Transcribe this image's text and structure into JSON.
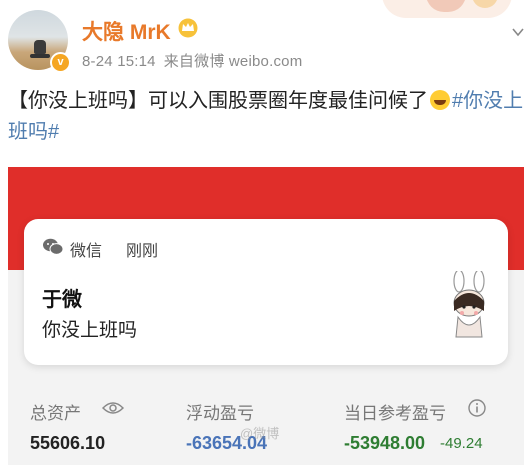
{
  "header": {
    "username": "大隐 MrK",
    "timestamp": "8-24 15:14",
    "source": "来自微博 weibo.com",
    "verified_badge": "v"
  },
  "post": {
    "text_main": "【你没上班吗】可以入围股票圈年度最佳问候了",
    "hashtag": "#你没上班吗#",
    "emoji": "laugh-tears-emoji"
  },
  "screenshot": {
    "notification": {
      "app": "微信",
      "time": "刚刚",
      "sender": "于微",
      "message": "你没上班吗"
    },
    "stats": {
      "total_assets_label": "总资产",
      "total_assets_value": "55606.10",
      "floating_pl_label": "浮动盈亏",
      "floating_pl_value": "-63654.04",
      "daily_pl_label": "当日参考盈亏",
      "daily_pl_value": "-53948.00",
      "daily_pl_small": "-49.24"
    },
    "watermark": "@微博"
  },
  "colors": {
    "username": "#e8792a",
    "hashtag": "#507daf",
    "red_bar": "#e02e2a",
    "negative_value": "#2e7d32",
    "floating_value": "#4a74b8"
  }
}
